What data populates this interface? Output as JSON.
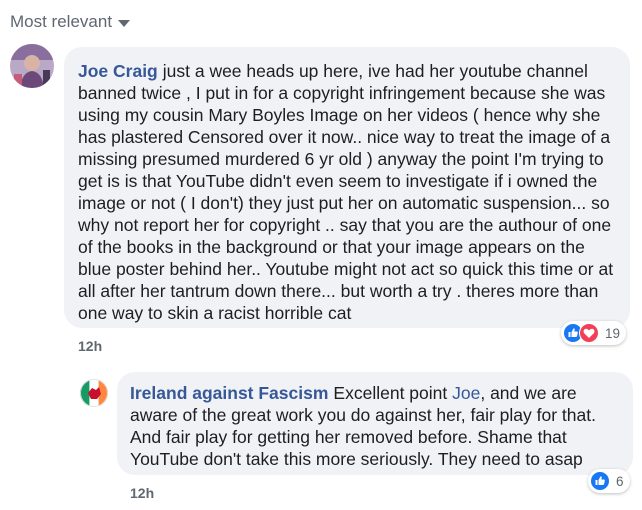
{
  "sort": {
    "label": "Most relevant"
  },
  "comments": [
    {
      "author": "Joe Craig",
      "text": "just a wee heads up here, ive had her youtube channel banned twice , I put in for a copyright infringement because she was using my cousin Mary Boyles Image on her videos ( hence why she has plastered Censored over it now.. nice way to treat the image of a missing presumed murdered 6 yr old ) anyway the point I'm trying to get is is that YouTube didn't even seem to investigate if i owned the image or not ( I don't) they just put her on automatic suspension... so why not report her for copyright .. say that you are the authour of one of the books in the background or that your image appears on the blue poster behind her.. Youtube might not act so quick this time or at all after her tantrum down there... but worth a try . theres more than one way to skin a racist horrible cat",
      "time": "12h",
      "reaction_count": "19",
      "reaction_icons": [
        "like-icon",
        "love-icon"
      ]
    },
    {
      "author": "Ireland against Fascism",
      "text_before": "Excellent point",
      "mention": "Joe",
      "text_after": ", and we are aware of the great work you do against her, fair play for that. And fair play for getting her removed before. Shame that YouTube don't take this more seriously. They need to asap",
      "time": "12h",
      "reaction_count": "6",
      "reaction_icons": [
        "like-icon"
      ]
    }
  ],
  "colors": {
    "author": "#365899",
    "bubble": "#f0f2f5",
    "like_blue": "#1877f2",
    "love_red": "#f33e58",
    "meta_gray": "#606770"
  }
}
